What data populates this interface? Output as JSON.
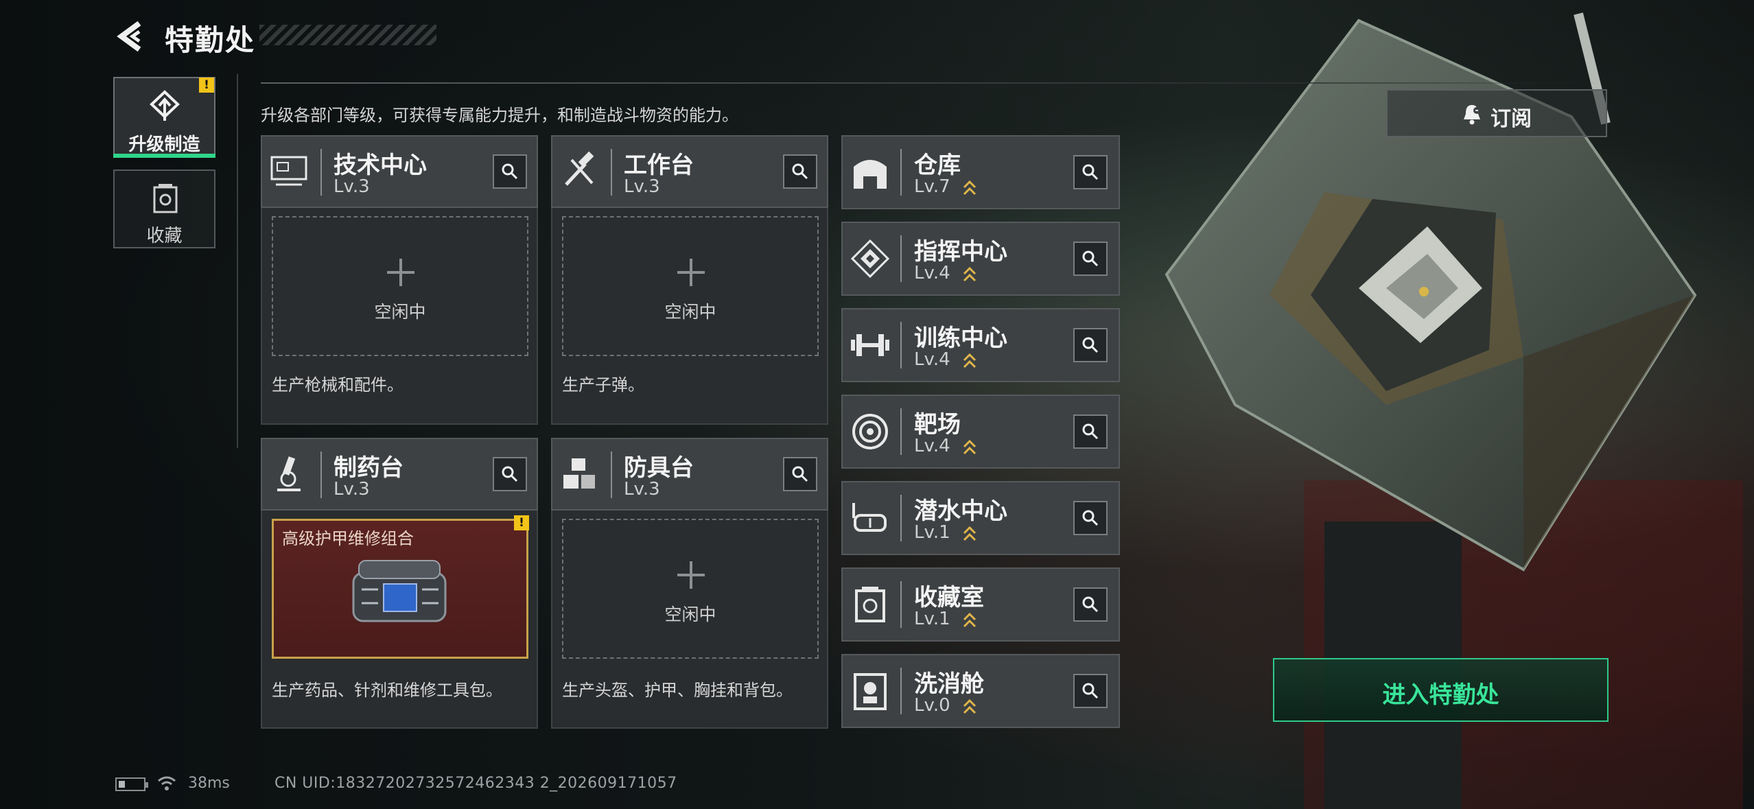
{
  "header": {
    "title": "特勤处"
  },
  "side_tabs": [
    {
      "label": "升级制造",
      "active": true,
      "warning": "!"
    },
    {
      "label": "收藏",
      "active": false
    }
  ],
  "intro": "升级各部门等级，可获得专属能力提升，和制造战斗物资的能力。",
  "subscribe": {
    "label": "订阅"
  },
  "stations": [
    {
      "name": "技术中心",
      "level": "Lv.3",
      "slot": "空闲中",
      "desc": "生产枪械和配件。"
    },
    {
      "name": "工作台",
      "level": "Lv.3",
      "slot": "空闲中",
      "desc": "生产子弹。"
    },
    {
      "name": "制药台",
      "level": "Lv.3",
      "slot_item": "高级护甲维修组合",
      "slot_warning": "!",
      "desc": "生产药品、针剂和维修工具包。"
    },
    {
      "name": "防具台",
      "level": "Lv.3",
      "slot": "空闲中",
      "desc": "生产头盔、护甲、胸挂和背包。"
    }
  ],
  "facilities": [
    {
      "name": "仓库",
      "level": "Lv.7",
      "upgradable": true
    },
    {
      "name": "指挥中心",
      "level": "Lv.4",
      "upgradable": true
    },
    {
      "name": "训练中心",
      "level": "Lv.4",
      "upgradable": true
    },
    {
      "name": "靶场",
      "level": "Lv.4",
      "upgradable": true
    },
    {
      "name": "潜水中心",
      "level": "Lv.1",
      "upgradable": true
    },
    {
      "name": "收藏室",
      "level": "Lv.1",
      "upgradable": true
    },
    {
      "name": "洗消舱",
      "level": "Lv.0",
      "upgradable": true
    }
  ],
  "enter_button": {
    "label": "进入特勤处"
  },
  "status": {
    "battery_fraction": 0.25,
    "ping": "38ms",
    "uid": "CN UID:18327202732572462343 2_202609171057"
  },
  "colors": {
    "accent": "#2fd58a",
    "warning": "#f2c318",
    "item_border": "#c9a24a",
    "upgrade_arrow": "#e0b54a"
  }
}
